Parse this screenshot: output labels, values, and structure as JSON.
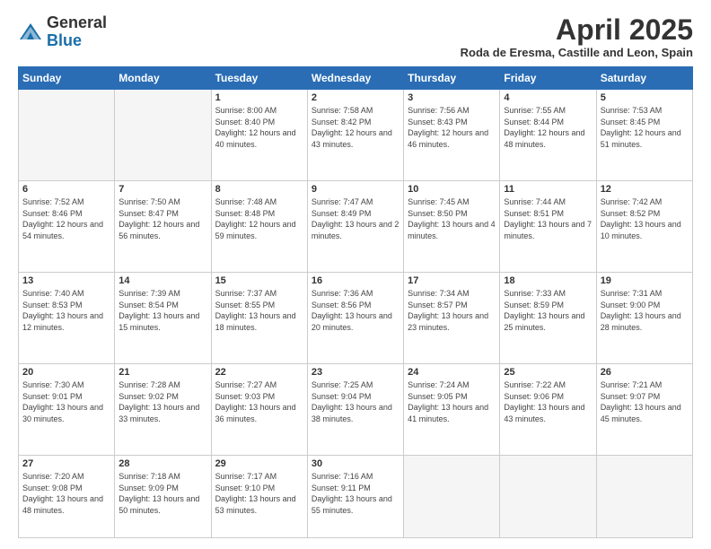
{
  "logo": {
    "general": "General",
    "blue": "Blue"
  },
  "header": {
    "month": "April 2025",
    "location": "Roda de Eresma, Castille and Leon, Spain"
  },
  "days_of_week": [
    "Sunday",
    "Monday",
    "Tuesday",
    "Wednesday",
    "Thursday",
    "Friday",
    "Saturday"
  ],
  "weeks": [
    [
      {
        "day": "",
        "info": "",
        "empty": true
      },
      {
        "day": "",
        "info": "",
        "empty": true
      },
      {
        "day": "1",
        "info": "Sunrise: 8:00 AM\nSunset: 8:40 PM\nDaylight: 12 hours and 40 minutes."
      },
      {
        "day": "2",
        "info": "Sunrise: 7:58 AM\nSunset: 8:42 PM\nDaylight: 12 hours and 43 minutes."
      },
      {
        "day": "3",
        "info": "Sunrise: 7:56 AM\nSunset: 8:43 PM\nDaylight: 12 hours and 46 minutes."
      },
      {
        "day": "4",
        "info": "Sunrise: 7:55 AM\nSunset: 8:44 PM\nDaylight: 12 hours and 48 minutes."
      },
      {
        "day": "5",
        "info": "Sunrise: 7:53 AM\nSunset: 8:45 PM\nDaylight: 12 hours and 51 minutes."
      }
    ],
    [
      {
        "day": "6",
        "info": "Sunrise: 7:52 AM\nSunset: 8:46 PM\nDaylight: 12 hours and 54 minutes."
      },
      {
        "day": "7",
        "info": "Sunrise: 7:50 AM\nSunset: 8:47 PM\nDaylight: 12 hours and 56 minutes."
      },
      {
        "day": "8",
        "info": "Sunrise: 7:48 AM\nSunset: 8:48 PM\nDaylight: 12 hours and 59 minutes."
      },
      {
        "day": "9",
        "info": "Sunrise: 7:47 AM\nSunset: 8:49 PM\nDaylight: 13 hours and 2 minutes."
      },
      {
        "day": "10",
        "info": "Sunrise: 7:45 AM\nSunset: 8:50 PM\nDaylight: 13 hours and 4 minutes."
      },
      {
        "day": "11",
        "info": "Sunrise: 7:44 AM\nSunset: 8:51 PM\nDaylight: 13 hours and 7 minutes."
      },
      {
        "day": "12",
        "info": "Sunrise: 7:42 AM\nSunset: 8:52 PM\nDaylight: 13 hours and 10 minutes."
      }
    ],
    [
      {
        "day": "13",
        "info": "Sunrise: 7:40 AM\nSunset: 8:53 PM\nDaylight: 13 hours and 12 minutes."
      },
      {
        "day": "14",
        "info": "Sunrise: 7:39 AM\nSunset: 8:54 PM\nDaylight: 13 hours and 15 minutes."
      },
      {
        "day": "15",
        "info": "Sunrise: 7:37 AM\nSunset: 8:55 PM\nDaylight: 13 hours and 18 minutes."
      },
      {
        "day": "16",
        "info": "Sunrise: 7:36 AM\nSunset: 8:56 PM\nDaylight: 13 hours and 20 minutes."
      },
      {
        "day": "17",
        "info": "Sunrise: 7:34 AM\nSunset: 8:57 PM\nDaylight: 13 hours and 23 minutes."
      },
      {
        "day": "18",
        "info": "Sunrise: 7:33 AM\nSunset: 8:59 PM\nDaylight: 13 hours and 25 minutes."
      },
      {
        "day": "19",
        "info": "Sunrise: 7:31 AM\nSunset: 9:00 PM\nDaylight: 13 hours and 28 minutes."
      }
    ],
    [
      {
        "day": "20",
        "info": "Sunrise: 7:30 AM\nSunset: 9:01 PM\nDaylight: 13 hours and 30 minutes."
      },
      {
        "day": "21",
        "info": "Sunrise: 7:28 AM\nSunset: 9:02 PM\nDaylight: 13 hours and 33 minutes."
      },
      {
        "day": "22",
        "info": "Sunrise: 7:27 AM\nSunset: 9:03 PM\nDaylight: 13 hours and 36 minutes."
      },
      {
        "day": "23",
        "info": "Sunrise: 7:25 AM\nSunset: 9:04 PM\nDaylight: 13 hours and 38 minutes."
      },
      {
        "day": "24",
        "info": "Sunrise: 7:24 AM\nSunset: 9:05 PM\nDaylight: 13 hours and 41 minutes."
      },
      {
        "day": "25",
        "info": "Sunrise: 7:22 AM\nSunset: 9:06 PM\nDaylight: 13 hours and 43 minutes."
      },
      {
        "day": "26",
        "info": "Sunrise: 7:21 AM\nSunset: 9:07 PM\nDaylight: 13 hours and 45 minutes."
      }
    ],
    [
      {
        "day": "27",
        "info": "Sunrise: 7:20 AM\nSunset: 9:08 PM\nDaylight: 13 hours and 48 minutes."
      },
      {
        "day": "28",
        "info": "Sunrise: 7:18 AM\nSunset: 9:09 PM\nDaylight: 13 hours and 50 minutes."
      },
      {
        "day": "29",
        "info": "Sunrise: 7:17 AM\nSunset: 9:10 PM\nDaylight: 13 hours and 53 minutes."
      },
      {
        "day": "30",
        "info": "Sunrise: 7:16 AM\nSunset: 9:11 PM\nDaylight: 13 hours and 55 minutes."
      },
      {
        "day": "",
        "info": "",
        "empty": true
      },
      {
        "day": "",
        "info": "",
        "empty": true
      },
      {
        "day": "",
        "info": "",
        "empty": true
      }
    ]
  ]
}
